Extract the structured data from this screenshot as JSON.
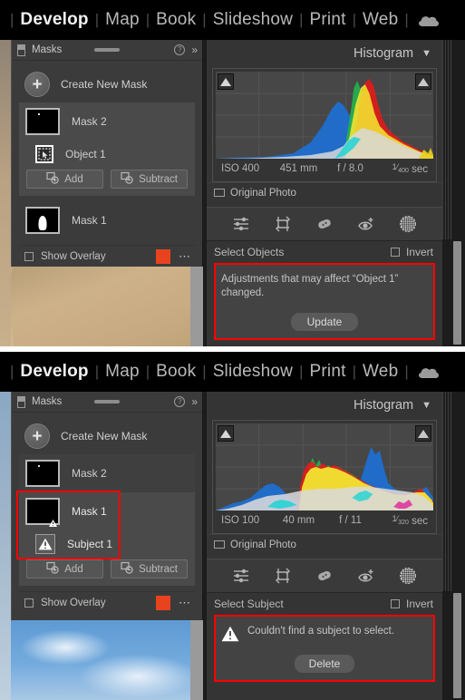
{
  "module_bar": {
    "items": [
      {
        "label": "Develop",
        "active": true
      },
      {
        "label": "Map",
        "active": false
      },
      {
        "label": "Book",
        "active": false
      },
      {
        "label": "Slideshow",
        "active": false
      },
      {
        "label": "Print",
        "active": false
      },
      {
        "label": "Web",
        "active": false
      }
    ],
    "separator": "|",
    "cloud_icon": "cloud-icon"
  },
  "panel_top": {
    "masks": {
      "title": "Masks",
      "help_icon": "question-mark-icon",
      "collapse_icon": "double-chevron-right-icon",
      "switch_icon": "panel-switch-icon",
      "create_new_mask": "Create New Mask",
      "plus_icon": "plus-icon",
      "items": [
        {
          "label": "Mask 2",
          "type": "mask",
          "selected": true,
          "warning": false
        },
        {
          "label": "Object 1",
          "type": "component",
          "icon": "object-select-icon",
          "warning": false
        }
      ],
      "add_label": "Add",
      "subtract_label": "Subtract",
      "add_icon": "add-mask-icon",
      "subtract_icon": "subtract-mask-icon",
      "secondary_mask": {
        "label": "Mask 1",
        "selected": false
      },
      "show_overlay": "Show Overlay",
      "overlay_color": "#e8431f",
      "more_icon": "ellipsis-icon"
    },
    "histogram": {
      "title": "Histogram",
      "collapse_icon": "triangle-down-icon",
      "shadow_clip_icon": "shadow-clipping-triangle",
      "highlight_clip_icon": "highlight-clipping-triangle",
      "iso": "ISO 400",
      "focal_length": "451 mm",
      "aperture": "f / 8.0",
      "shutter_numerator": "1",
      "shutter_denominator": "400",
      "shutter_unit": "sec",
      "original_photo": "Original Photo"
    },
    "tools": [
      {
        "name": "basic-adjust-icon"
      },
      {
        "name": "crop-overlay-icon"
      },
      {
        "name": "healing-brush-icon"
      },
      {
        "name": "red-eye-icon"
      },
      {
        "name": "masking-icon"
      }
    ],
    "mask_options": {
      "mode_label": "Select Objects",
      "invert_label": "Invert",
      "message": "Adjustments that may affect “Object 1” changed.",
      "button": "Update"
    }
  },
  "panel_bottom": {
    "masks": {
      "title": "Masks",
      "help_icon": "question-mark-icon",
      "collapse_icon": "double-chevron-right-icon",
      "switch_icon": "panel-switch-icon",
      "create_new_mask": "Create New Mask",
      "plus_icon": "plus-icon",
      "items": [
        {
          "label": "Mask 2",
          "type": "mask",
          "selected": false,
          "warning": false
        },
        {
          "label": "Mask 1",
          "type": "mask",
          "selected": true,
          "warning": true
        },
        {
          "label": "Subject 1",
          "type": "component",
          "icon": "warning-triangle-icon",
          "warning": true
        }
      ],
      "add_label": "Add",
      "subtract_label": "Subtract",
      "add_icon": "add-mask-icon",
      "subtract_icon": "subtract-mask-icon",
      "show_overlay": "Show Overlay",
      "overlay_color": "#e8431f",
      "more_icon": "ellipsis-icon"
    },
    "histogram": {
      "title": "Histogram",
      "collapse_icon": "triangle-down-icon",
      "shadow_clip_icon": "shadow-clipping-triangle",
      "highlight_clip_icon": "highlight-clipping-triangle",
      "iso": "ISO 100",
      "focal_length": "40 mm",
      "aperture": "f / 11",
      "shutter_numerator": "1",
      "shutter_denominator": "320",
      "shutter_unit": "sec",
      "original_photo": "Original Photo"
    },
    "tools": [
      {
        "name": "basic-adjust-icon"
      },
      {
        "name": "crop-overlay-icon"
      },
      {
        "name": "healing-brush-icon"
      },
      {
        "name": "red-eye-icon"
      },
      {
        "name": "masking-icon"
      }
    ],
    "mask_options": {
      "mode_label": "Select Subject",
      "invert_label": "Invert",
      "message": "Couldn't find a subject to select.",
      "warning_icon": "warning-triangle-icon",
      "button": "Delete"
    }
  }
}
